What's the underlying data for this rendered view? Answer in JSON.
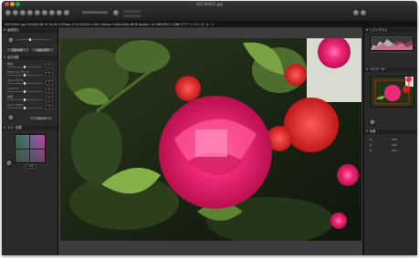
{
  "window": {
    "title": "DSC00001.jpg"
  },
  "infobar": {
    "text": "DSC00001.jpg 2010/05/18 12:34:56  1/250sec  F5.6  ISO100  0.0EV  105mm  5184x3456  sRGB  Quality: 10  FINE  JPEG  3.2MB  ホワイトバランス: オート"
  },
  "left_panel": {
    "panel1_title": "画像表示",
    "btn_a": "画像を開く",
    "btn_b": "画像を保存",
    "panel2_title": "画質調整",
    "rows": [
      {
        "label": "露出",
        "value": "0"
      },
      {
        "label": "ホワイトバランス",
        "value": "0"
      },
      {
        "label": "コントラスト",
        "value": "0"
      },
      {
        "label": "シャドウ",
        "value": "0"
      },
      {
        "label": "彩度",
        "value": "0"
      },
      {
        "label": "シャープネス",
        "value": "0"
      }
    ],
    "reset_label": "リセット",
    "panel3_title": "カラー調整",
    "color_value": "0.00"
  },
  "right_panel": {
    "histogram_title": "ヒストグラム",
    "navigator_title": "ナビゲーター",
    "info_title": "情報",
    "info_rows": [
      {
        "k": "R",
        "v": "255"
      },
      {
        "k": "G",
        "v": "128"
      },
      {
        "k": "B",
        "v": "164"
      }
    ]
  },
  "colors": {
    "accent": "#e8246e",
    "panel": "#2a2a2a",
    "viewer": "#3c3c3c"
  }
}
